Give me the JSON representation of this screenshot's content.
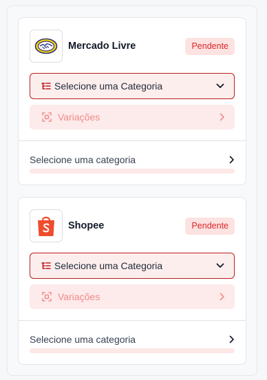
{
  "integrations": [
    {
      "name": "Mercado Livre",
      "logo_icon": "mercado-livre-handshake-icon",
      "status": "Pendente",
      "category_select": "Selecione uma Categoria",
      "variations_label": "Variações",
      "category_row": "Selecione uma categoria",
      "progress": 0
    },
    {
      "name": "Shopee",
      "logo_icon": "shopee-bag-icon",
      "status": "Pendente",
      "category_select": "Selecione uma Categoria",
      "variations_label": "Variações",
      "category_row": "Selecione uma categoria",
      "progress": 0
    }
  ],
  "colors": {
    "status_bg": "#fde2e2",
    "status_text": "#dc2626",
    "select_border": "#b91c1c",
    "shopee_orange": "#ee4d2d",
    "meli_yellow": "#ffd60a"
  }
}
